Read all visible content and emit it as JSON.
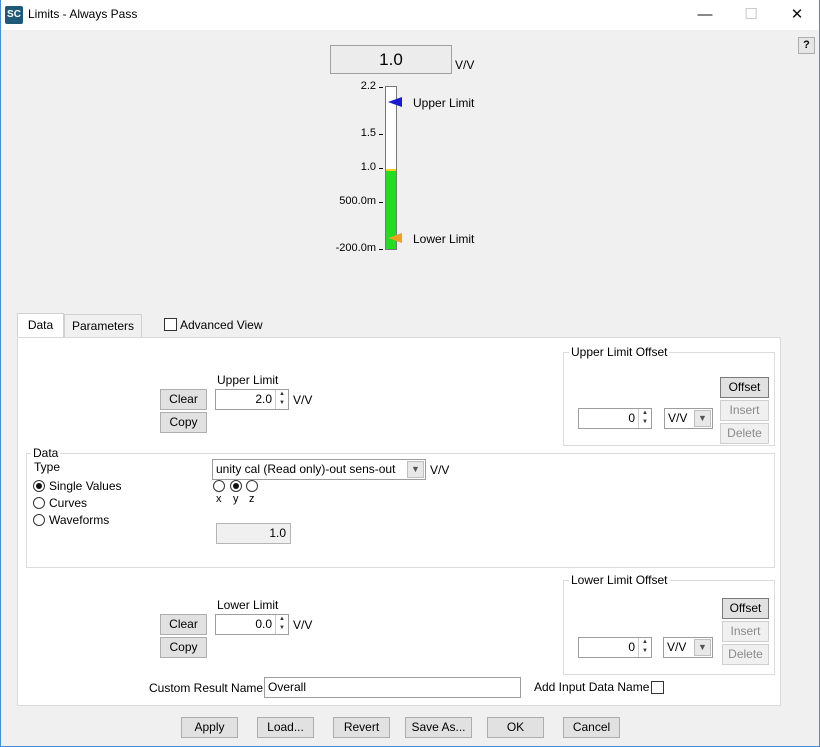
{
  "window": {
    "icon_text": "SC",
    "title": "Limits  - Always Pass",
    "minimize": "—",
    "maximize": "☐",
    "close": "✕",
    "help": "?"
  },
  "gauge": {
    "readout_value": "1.0",
    "readout_unit": "V/V",
    "ticks": [
      "2.2",
      "1.5",
      "1.0",
      "500.0m",
      "-200.0m"
    ],
    "scale_min": -0.2,
    "scale_max": 2.2,
    "current_value": 1.0,
    "upper_limit_label": "Upper Limit",
    "lower_limit_label": "Lower Limit",
    "upper_marker_color": "#1a1ad0",
    "lower_marker_color": "#f0a020",
    "fill_color": "#22dd22"
  },
  "tabs": {
    "data": "Data",
    "parameters": "Parameters",
    "advanced_view": "Advanced View"
  },
  "upper": {
    "clear": "Clear",
    "copy": "Copy",
    "title": "Upper Limit",
    "value": "2.0",
    "unit": "V/V",
    "offset_group": "Upper Limit Offset",
    "offset_btn": "Offset",
    "insert_btn": "Insert",
    "delete_btn": "Delete",
    "offset_value": "0",
    "offset_unit": "V/V"
  },
  "data_group": {
    "title": "Data",
    "type_label": "Type",
    "options": [
      "Single Values",
      "Curves",
      "Waveforms"
    ],
    "selected_option": "Single Values",
    "source": "unity cal (Read only)-out sens-out",
    "source_unit": "V/V",
    "axes": [
      "x",
      "y",
      "z"
    ],
    "selected_axis": "y",
    "value": "1.0"
  },
  "lower": {
    "clear": "Clear",
    "copy": "Copy",
    "title": "Lower Limit",
    "value": "0.0",
    "unit": "V/V",
    "offset_group": "Lower Limit Offset",
    "offset_btn": "Offset",
    "insert_btn": "Insert",
    "delete_btn": "Delete",
    "offset_value": "0",
    "offset_unit": "V/V"
  },
  "footer": {
    "custom_result_label": "Custom Result Name",
    "custom_result_value": "Overall",
    "add_input_label": "Add Input Data Name",
    "apply": "Apply",
    "load": "Load...",
    "revert": "Revert",
    "save_as": "Save As...",
    "ok": "OK",
    "cancel": "Cancel"
  }
}
